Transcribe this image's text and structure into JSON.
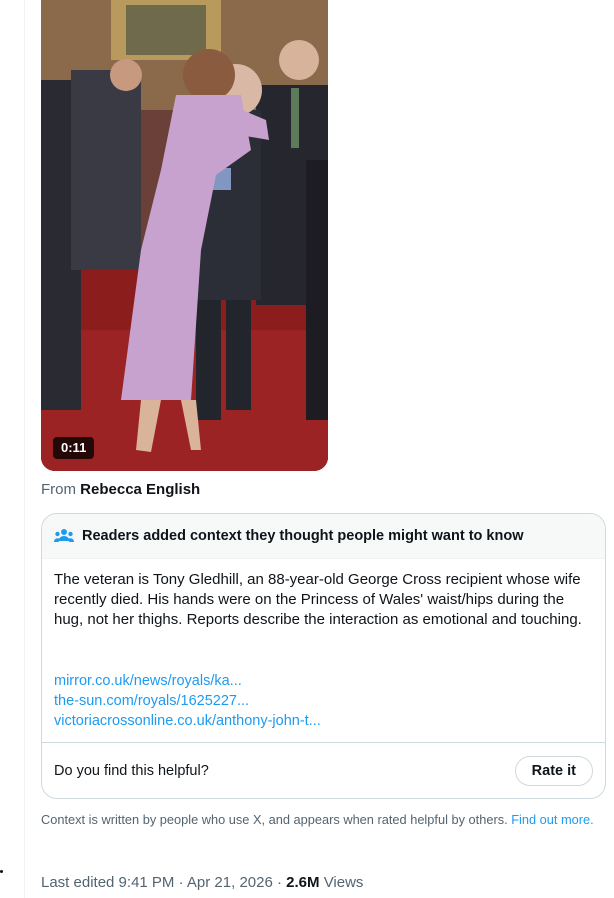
{
  "video": {
    "duration": "0:11"
  },
  "source": {
    "prefix": "From",
    "name": "Rebecca English"
  },
  "note": {
    "header_icon": "people-icon",
    "header_title": "Readers added context they thought people might want to know",
    "body": "The veteran is Tony Gledhill, an 88-year-old George Cross recipient whose wife recently died. His hands were on the Princess of Wales' waist/hips during the hug, not her thighs. Reports describe the interaction as emotional and touching.",
    "links": [
      "mirror.co.uk/news/royals/ka...",
      "the-sun.com/royals/1625227...",
      "victoriacrossonline.co.uk/anthony-john-t..."
    ],
    "helpful_question": "Do you find this helpful?",
    "rate_button": "Rate it"
  },
  "context_note": {
    "text": "Context is written by people who use X, and appears when rated helpful by others.",
    "link": "Find out more."
  },
  "meta": {
    "edited": "Last edited 9:41 PM · Apr 21, 2026 ·",
    "views_count": "2.6M",
    "views_label": "Views"
  },
  "colors": {
    "link": "#1d9bf0",
    "muted": "#536471",
    "text": "#0f1419",
    "border": "#cfd9de"
  }
}
